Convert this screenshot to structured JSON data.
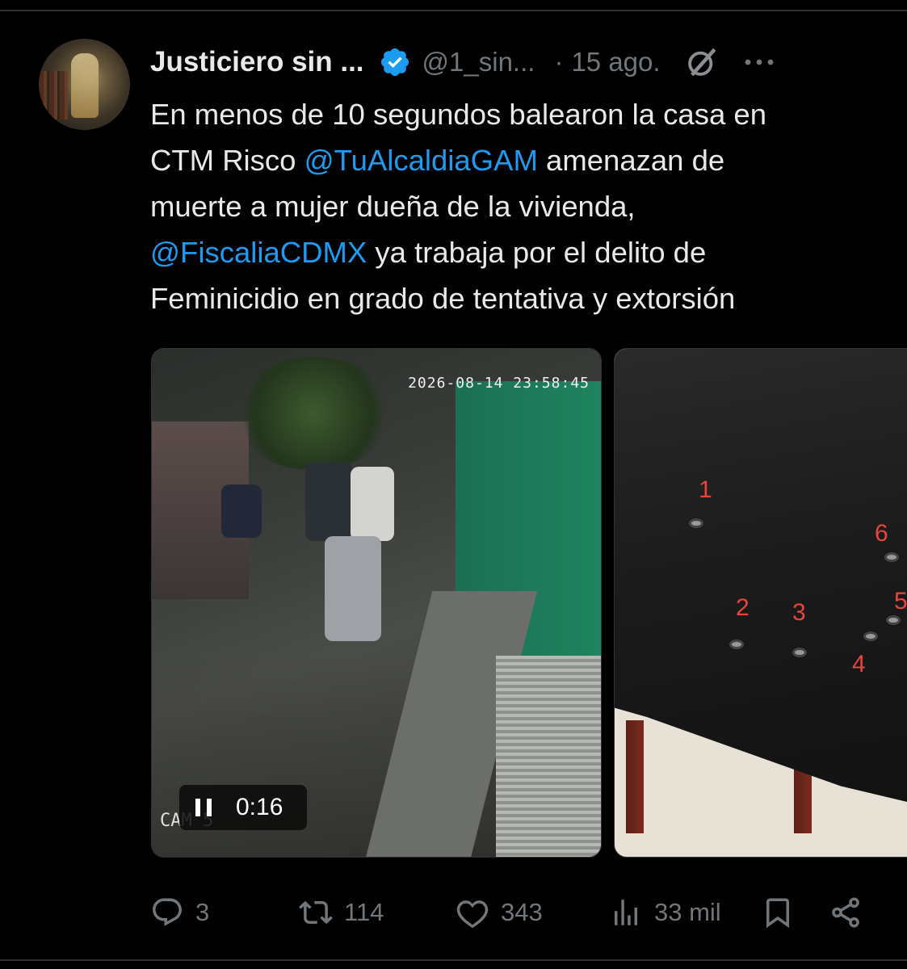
{
  "author": {
    "name": "Justiciero sin ...",
    "handle": "@1_sin...",
    "separator": "·",
    "date": "15 ago.",
    "verified": true
  },
  "tweet": {
    "line1": "En menos de 10 segundos balearon la casa en",
    "line2_prefix": "CTM Risco ",
    "mention1": "@TuAlcaldiaGAM",
    "line2_suffix": " amenazan de",
    "line3": "muerte a mujer dueña de la vivienda,",
    "mention2": "@FiscaliaCDMX",
    "line4_suffix": " ya trabaja por el delito de",
    "line5": "Feminicidio en grado de tentativa y extorsión"
  },
  "media": {
    "video": {
      "timestamp": "2026-08-14 23:58:45",
      "cam_label": "CAM 5",
      "duration": "0:16",
      "state": "playing"
    },
    "photo_labels": [
      "1",
      "2",
      "3",
      "4",
      "5",
      "6"
    ]
  },
  "actions": {
    "replies": "3",
    "reposts": "114",
    "likes": "343",
    "views": "33 mil"
  },
  "colors": {
    "background": "#000000",
    "text": "#e7e9ea",
    "secondary": "#71767b",
    "mention": "#1d9bf0",
    "verified": "#1d9bf0"
  },
  "icons": [
    "verified-badge-icon",
    "grok-icon",
    "more-icon",
    "pause-icon",
    "reply-icon",
    "repost-icon",
    "like-icon",
    "views-icon",
    "bookmark-icon",
    "share-icon"
  ]
}
